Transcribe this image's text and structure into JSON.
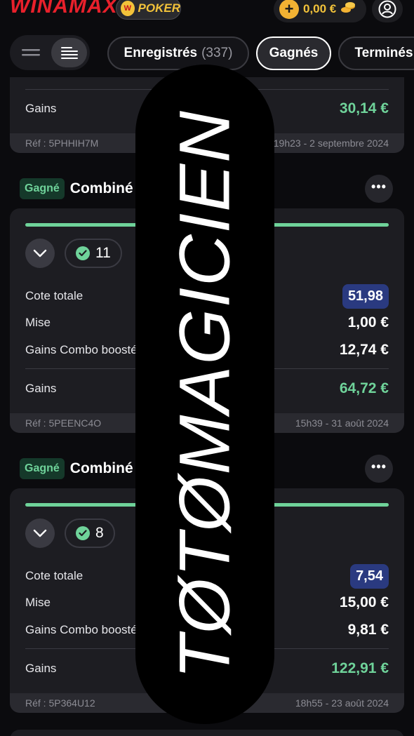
{
  "header": {
    "brand": "WINAMAX",
    "poker_label": "POKER",
    "balance": "0,00 €",
    "plus_symbol": "+"
  },
  "filters": {
    "tabs": [
      {
        "label": "Enregistrés",
        "count": "(337)"
      },
      {
        "label": "Gagnés",
        "count": ""
      },
      {
        "label": "Terminés",
        "count": ""
      }
    ],
    "active": "Gagnés"
  },
  "cards": [
    {
      "gains_label": "Gains",
      "gains_value": "30,14 €",
      "ref": "Réf : 5PHHIH7M",
      "date": "19h23 - 2 septembre 2024"
    },
    {
      "status": "Gagné",
      "title": "Combiné",
      "selections": "11",
      "cote_label": "Cote totale",
      "cote_value": "51,98",
      "mise_label": "Mise",
      "mise_value": "1,00 €",
      "combo_label": "Gains Combo boosté",
      "combo_value": "12,74 €",
      "gains_label": "Gains",
      "gains_value": "64,72 €",
      "ref": "Réf : 5PEENC4O",
      "date": "15h39 - 31 août 2024"
    },
    {
      "status": "Gagné",
      "title": "Combiné",
      "selections": "8",
      "cote_label": "Cote totale",
      "cote_value": "7,54",
      "mise_label": "Mise",
      "mise_value": "15,00 €",
      "combo_label": "Gains Combo boosté",
      "combo_value": "9,81 €",
      "gains_label": "Gains",
      "gains_value": "122,91 €",
      "ref": "Réf : 5P364U12",
      "date": "18h55 - 23 août 2024"
    }
  ],
  "overlay": {
    "text": "TØTØMAGICIEN"
  },
  "colors": {
    "accent_green": "#6fd39a",
    "brand_red": "#e8202b",
    "gold": "#f2b233",
    "cote_badge": "#2a3a80"
  }
}
